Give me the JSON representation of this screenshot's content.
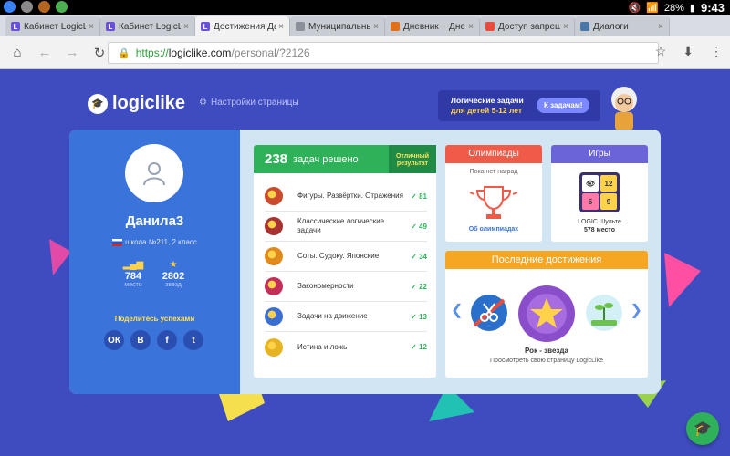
{
  "status_bar": {
    "battery": "28%",
    "time": "9:43"
  },
  "tabs": [
    {
      "title": "Кабинет LogicLi",
      "fav": "L",
      "fav_color": "#6a4fd8",
      "active": false
    },
    {
      "title": "Кабинет LogicLi",
      "fav": "L",
      "fav_color": "#6a4fd8",
      "active": false
    },
    {
      "title": "Достижения Да",
      "fav": "L",
      "fav_color": "#6a4fd8",
      "active": true
    },
    {
      "title": "Муниципальны",
      "fav": "",
      "fav_color": "#8a8f99",
      "active": false
    },
    {
      "title": "Дневник ~ Днев",
      "fav": "",
      "fav_color": "#e0701c",
      "active": false
    },
    {
      "title": "Доступ запреще",
      "fav": "",
      "fav_color": "#e74c3c",
      "active": false
    },
    {
      "title": "Диалоги",
      "fav": "",
      "fav_color": "#4a76a8",
      "active": false
    }
  ],
  "tab_close_glyph": "×",
  "url": {
    "protocol": "https://",
    "host": "logiclike.com",
    "path": "/personal/?2126"
  },
  "site": {
    "logo_text": "logiclike",
    "settings_label": "Настройки страницы",
    "promo_line1": "Логические задачи",
    "promo_line2": "для детей 5-12 лет",
    "promo_button": "К задачам!"
  },
  "profile": {
    "name": "Данила3",
    "school": "школа №211, 2 класс",
    "place_value": "784",
    "place_label": "место",
    "stars_value": "2802",
    "stars_label": "звезд",
    "share_label": "Поделитесь успехами",
    "socials": [
      "ОК",
      "В",
      "f",
      "t"
    ]
  },
  "tasks": {
    "count": "238",
    "label": "задач решено",
    "badge": "Отличный результат",
    "rows": [
      {
        "name": "Фигуры. Развёртки. Отражения",
        "count": "81",
        "color": "#c94a2c"
      },
      {
        "name": "Классические логические задачи",
        "count": "49",
        "color": "#a83232"
      },
      {
        "name": "Соты. Судоку. Японские",
        "count": "34",
        "color": "#e08a1e"
      },
      {
        "name": "Закономерности",
        "count": "22",
        "color": "#c2305a"
      },
      {
        "name": "Задачи на движение",
        "count": "13",
        "color": "#3a6fd1"
      },
      {
        "name": "Истина и ложь",
        "count": "12",
        "color": "#e6b422"
      }
    ]
  },
  "olympiads": {
    "title": "Олимпиады",
    "no_awards": "Пока нет наград",
    "link": "Об олимпиадах"
  },
  "games": {
    "title": "Игры",
    "cells": [
      "👁",
      "12",
      "5",
      "9"
    ],
    "game_name": "LOGIC Шульте",
    "place": "578 место"
  },
  "achievements": {
    "title": "Последние достижения",
    "name": "Рок - звезда",
    "description": "Просмотреть свою страницу LogicLike"
  }
}
